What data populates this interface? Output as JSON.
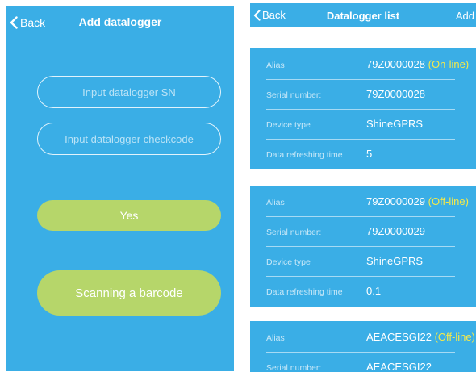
{
  "add_screen": {
    "back_label": "Back",
    "title": "Add datalogger",
    "sn_placeholder": "Input datalogger SN",
    "checkcode_placeholder": "Input datalogger checkcode",
    "yes_label": "Yes",
    "scan_label": "Scanning a barcode"
  },
  "list_screen": {
    "back_label": "Back",
    "title": "Datalogger list",
    "add_label": "Add",
    "labels": {
      "alias": "Alias",
      "serial": "Serial number:",
      "device_type": "Device type",
      "refresh": "Data refreshing time"
    },
    "cards": [
      {
        "alias": "79Z0000028",
        "status": "(On-line)",
        "serial": "79Z0000028",
        "device_type": "ShineGPRS",
        "refresh": "5"
      },
      {
        "alias": "79Z0000029",
        "status": "(Off-line)",
        "serial": "79Z0000029",
        "device_type": "ShineGPRS",
        "refresh": "0.1"
      },
      {
        "alias": "AEACESGI22",
        "status": "(Off-line)",
        "serial": "AEACESGI22"
      }
    ]
  },
  "colors": {
    "background_blue": "#3aaee6",
    "button_green": "#b6d66a",
    "status_yellow": "#f4e94a"
  }
}
